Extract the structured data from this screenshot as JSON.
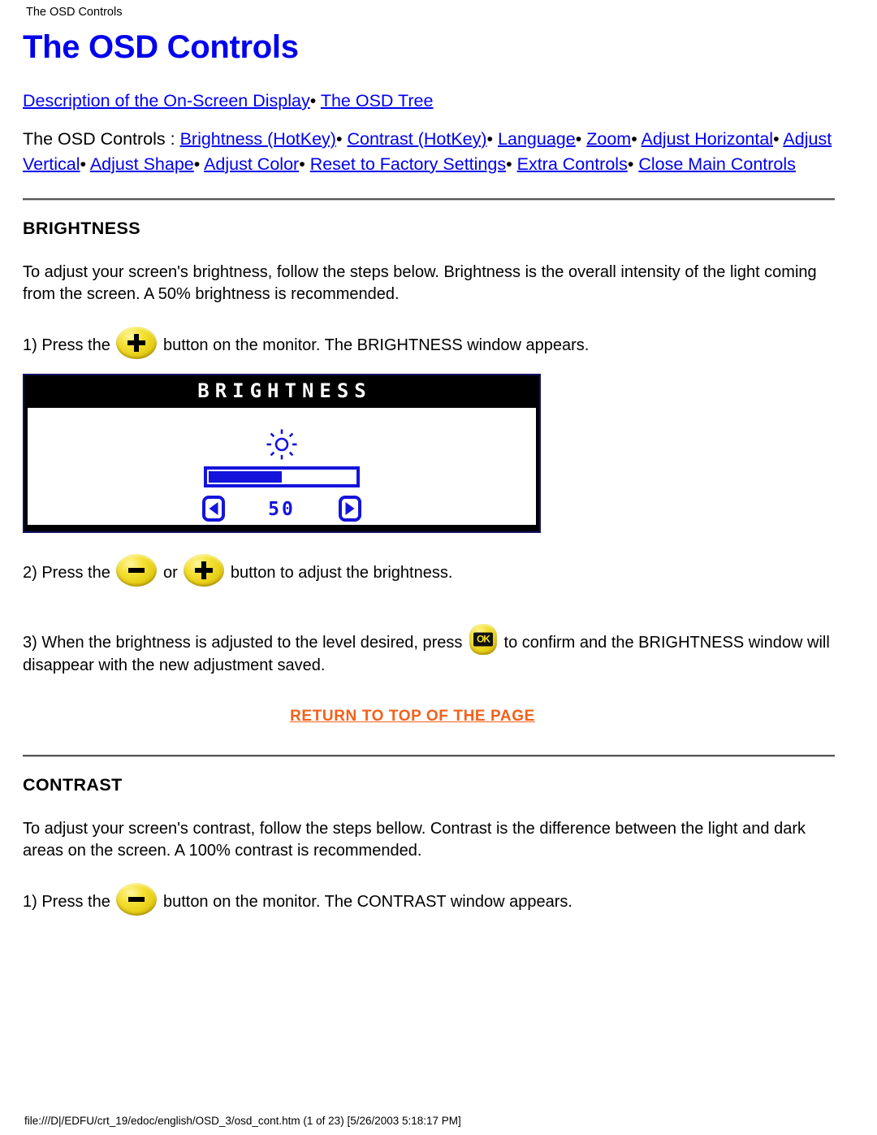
{
  "document": {
    "running_head": "The OSD Controls",
    "title": "The OSD Controls",
    "footer": "file:///D|/EDFU/crt_19/edoc/english/OSD_3/osd_cont.htm (1 of 23) [5/26/2003 5:18:17 PM]"
  },
  "colors": {
    "link": "#0000ee",
    "return_link": "#f4601a",
    "osd_blue": "#1414dc",
    "button_yellow": "#f5e033",
    "text": "#000000"
  },
  "nav": {
    "line1": {
      "links": [
        {
          "label": "Description of the On-Screen Display"
        },
        {
          "label": "The OSD Tree"
        }
      ],
      "separator": "•"
    },
    "line2": {
      "prefix": "The OSD Controls :",
      "separator": "•",
      "links": [
        {
          "label": "Brightness (HotKey)"
        },
        {
          "label": "Contrast (HotKey)"
        },
        {
          "label": "Language"
        },
        {
          "label": "Zoom"
        },
        {
          "label": "Adjust Horizontal"
        },
        {
          "label": "Adjust Vertical"
        },
        {
          "label": "Adjust Shape"
        },
        {
          "label": "Adjust Color"
        },
        {
          "label": "Reset to Factory Settings"
        },
        {
          "label": "Extra Controls"
        },
        {
          "label": "Close Main Controls"
        }
      ]
    }
  },
  "sections": {
    "brightness": {
      "heading": "BRIGHTNESS",
      "intro": "To adjust your screen's brightness, follow the steps below. Brightness is the overall intensity of the light coming from the screen. A 50% brightness is recommended.",
      "step1_before": "1) Press the",
      "step1_after": "button on the monitor. The BRIGHTNESS window appears.",
      "step2_before": "2) Press the",
      "step2_middle": "or",
      "step2_after": "button to adjust the brightness.",
      "step3_before": "3) When the brightness is adjusted to the level desired, press",
      "step3_after": "to confirm and the BRIGHTNESS window will disappear with the new adjustment saved.",
      "osd": {
        "title": "BRIGHTNESS",
        "value": "50",
        "fill_percent": 50,
        "icon": "sun-icon",
        "left_arrow": "◀",
        "right_arrow": "▶"
      }
    },
    "contrast": {
      "heading": "CONTRAST",
      "intro": "To adjust your screen's contrast, follow the steps bellow. Contrast is the difference between the light and dark areas on the screen. A 100% contrast is recommended.",
      "step1_before": "1) Press the",
      "step1_after": "button on the monitor. The CONTRAST window appears."
    }
  },
  "return_to_top": {
    "label": "RETURN TO TOP OF THE PAGE"
  },
  "buttons": {
    "plus_label": "+",
    "minus_label": "−",
    "ok_label": "OK"
  }
}
